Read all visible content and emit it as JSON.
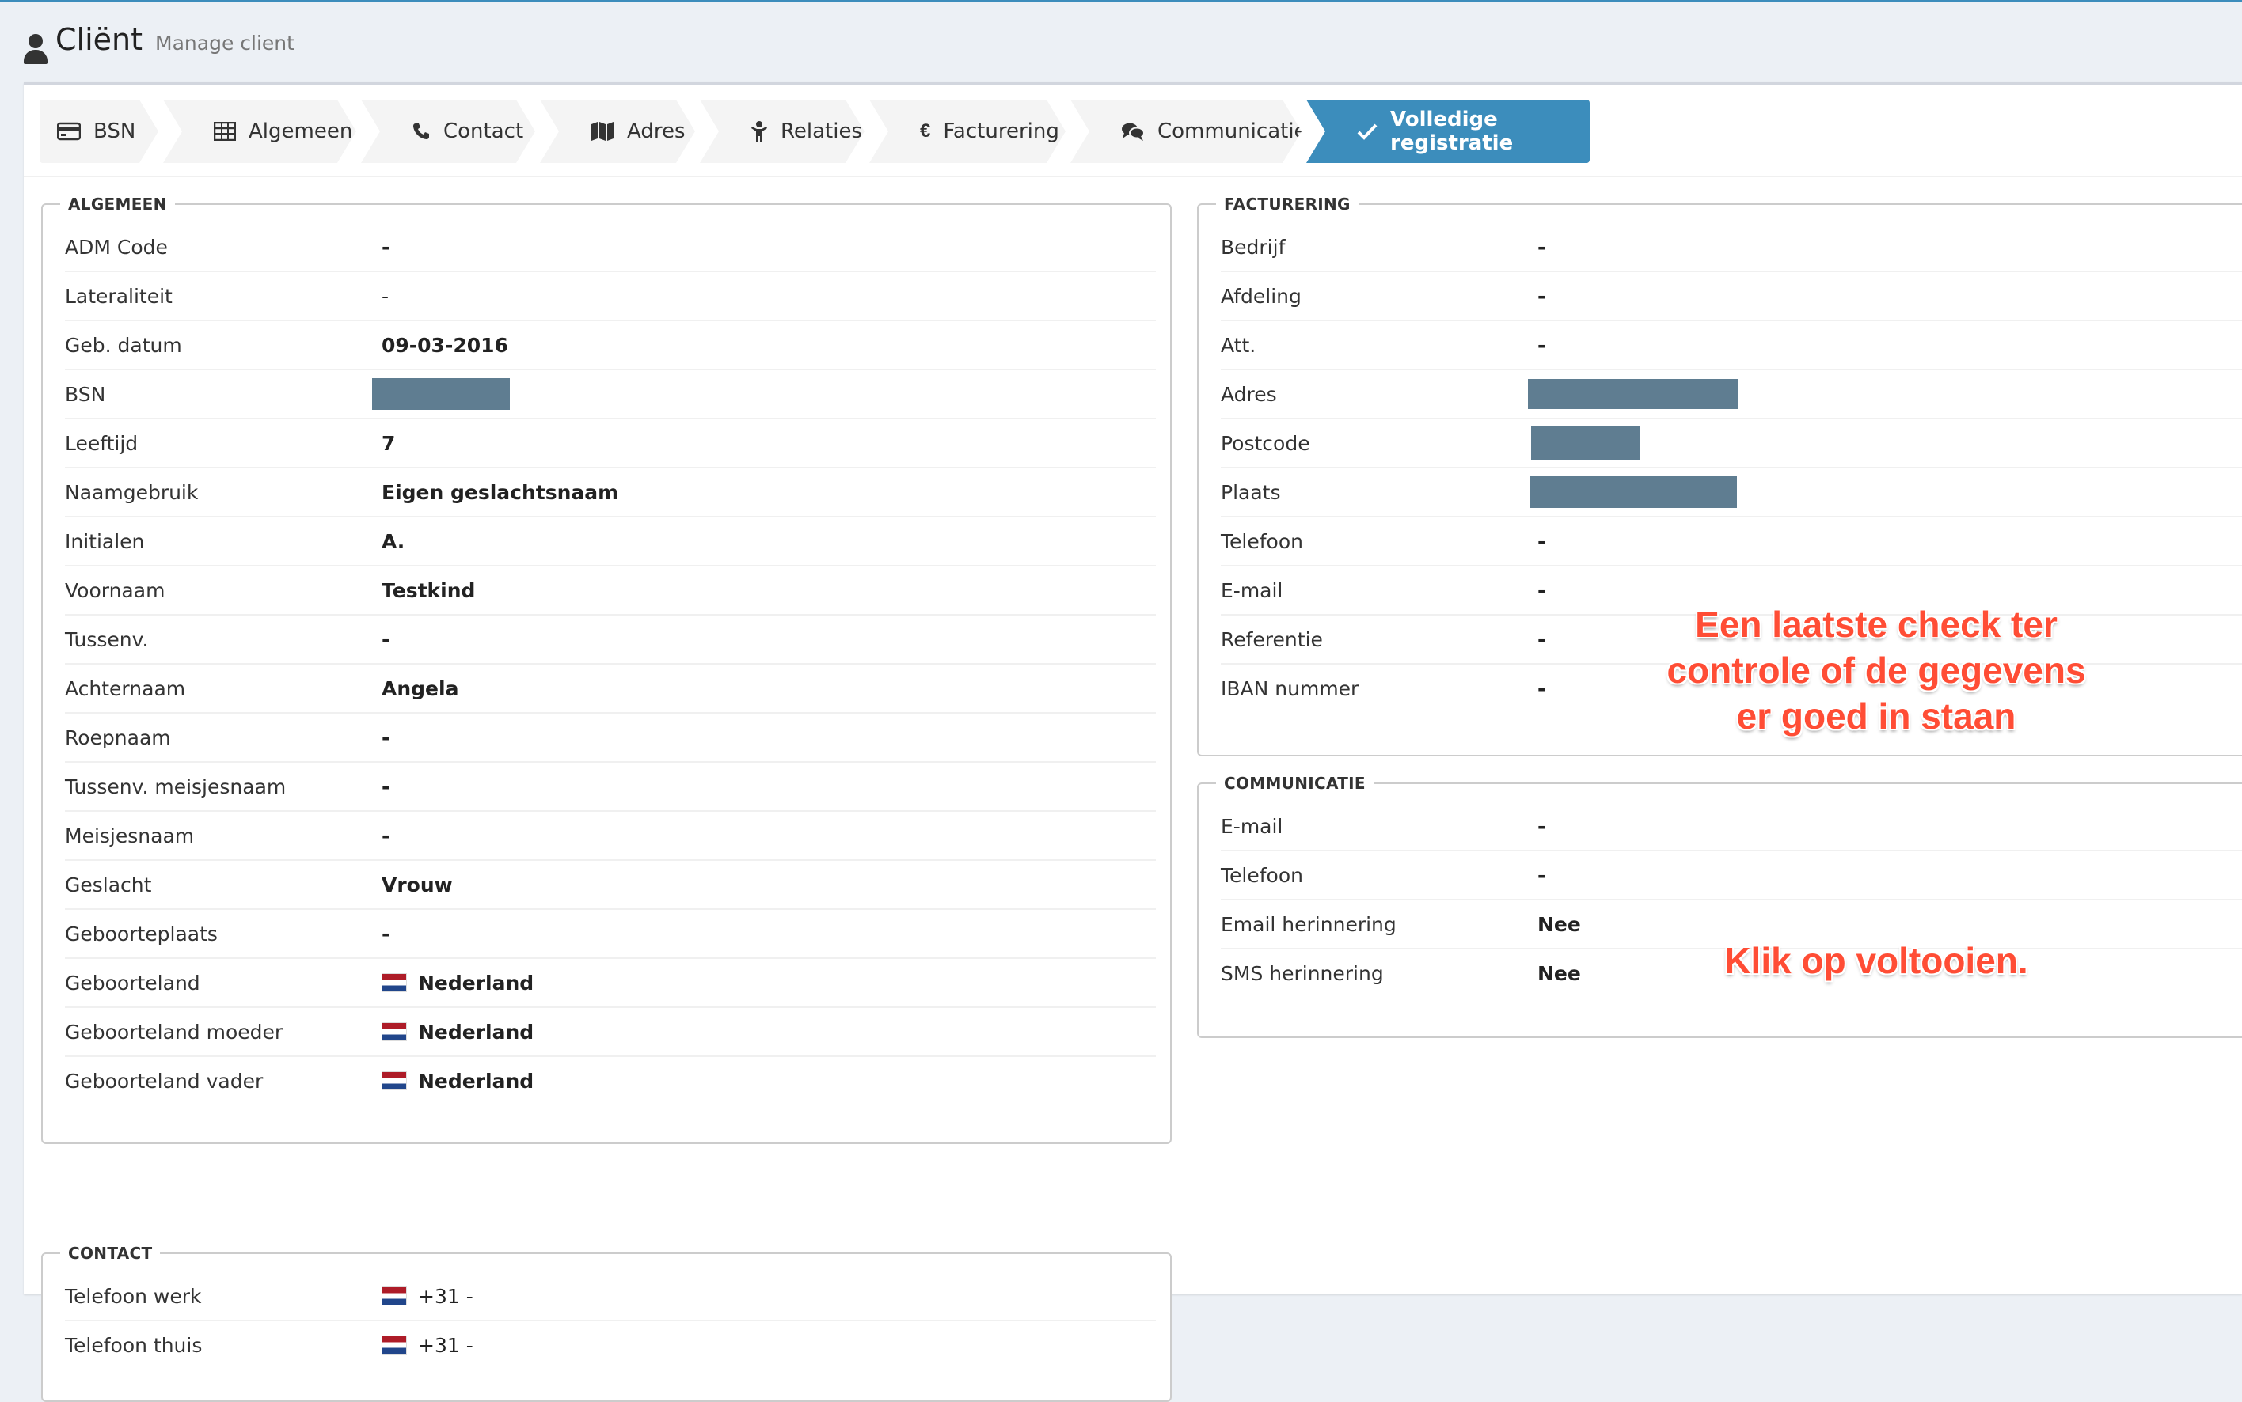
{
  "header": {
    "title": "Cliënt",
    "subtitle": "Manage client"
  },
  "wizard": {
    "steps": [
      {
        "label": "BSN",
        "icon": "credit-card-icon"
      },
      {
        "label": "Algemeen",
        "icon": "table-icon"
      },
      {
        "label": "Contact",
        "icon": "phone-icon"
      },
      {
        "label": "Adres",
        "icon": "map-icon"
      },
      {
        "label": "Relaties",
        "icon": "child-icon"
      },
      {
        "label": "Facturering",
        "icon": "euro-icon"
      },
      {
        "label": "Communicatie",
        "icon": "comments-icon"
      },
      {
        "label": "Volledige registratie",
        "icon": "check-icon",
        "active": true
      }
    ]
  },
  "algemeen": {
    "title": "ALGEMEEN",
    "rows": [
      {
        "label": "ADM Code",
        "value": "-"
      },
      {
        "label": "Lateraliteit",
        "value": "-"
      },
      {
        "label": "Geb. datum",
        "value": "09-03-2016"
      },
      {
        "label": "BSN",
        "value": ""
      },
      {
        "label": "Leeftijd",
        "value": "7"
      },
      {
        "label": "Naamgebruik",
        "value": "Eigen geslachtsnaam"
      },
      {
        "label": "Initialen",
        "value": "A."
      },
      {
        "label": "Voornaam",
        "value": "Testkind"
      },
      {
        "label": "Tussenv.",
        "value": "-"
      },
      {
        "label": "Achternaam",
        "value": "Angela"
      },
      {
        "label": "Roepnaam",
        "value": "-"
      },
      {
        "label": "Tussenv. meisjesnaam",
        "value": "-"
      },
      {
        "label": "Meisjesnaam",
        "value": "-"
      },
      {
        "label": "Geslacht",
        "value": "Vrouw"
      },
      {
        "label": "Geboorteplaats",
        "value": "-"
      },
      {
        "label": "Geboorteland",
        "value": "Nederland"
      },
      {
        "label": "Geboorteland moeder",
        "value": "Nederland"
      },
      {
        "label": "Geboorteland vader",
        "value": "Nederland"
      }
    ]
  },
  "contact": {
    "title": "CONTACT",
    "rows": [
      {
        "label": "Telefoon werk",
        "value": "+31 -"
      },
      {
        "label": "Telefoon thuis",
        "value": "+31 -"
      }
    ]
  },
  "facturering": {
    "title": "FACTURERING",
    "rows": [
      {
        "label": "Bedrijf",
        "value": "-"
      },
      {
        "label": "Afdeling",
        "value": "-"
      },
      {
        "label": "Att.",
        "value": "-"
      },
      {
        "label": "Adres",
        "value": ""
      },
      {
        "label": "Postcode",
        "value": ""
      },
      {
        "label": "Plaats",
        "value": ""
      },
      {
        "label": "Telefoon",
        "value": "-"
      },
      {
        "label": "E-mail",
        "value": "-"
      },
      {
        "label": "Referentie",
        "value": "-"
      },
      {
        "label": "IBAN nummer",
        "value": "-"
      }
    ]
  },
  "communicatie": {
    "title": "COMMUNICATIE",
    "rows": [
      {
        "label": "E-mail",
        "value": "-"
      },
      {
        "label": "Telefoon",
        "value": "-"
      },
      {
        "label": "Email herinnering",
        "value": "Nee"
      },
      {
        "label": "SMS herinnering",
        "value": "Nee"
      }
    ]
  },
  "annotations": {
    "check_line1": "Een laatste check ter",
    "check_line2": "controle of de gegevens",
    "check_line3": "er goed in staan",
    "finish": "Klik op voltooien."
  },
  "colors": {
    "primary": "#3c8dbc",
    "annotation": "#ff4d35",
    "redaction": "#5f7d91"
  }
}
